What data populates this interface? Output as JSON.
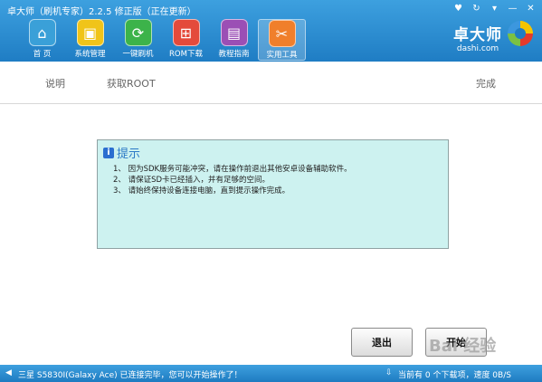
{
  "window": {
    "title": "卓大师（刷机专家）2.2.5 修正版（正在更新）",
    "controls": [
      "♥",
      "↻",
      "▾",
      "—",
      "✕"
    ]
  },
  "toolbar": {
    "items": [
      {
        "label": "首 页",
        "icon": "home-icon",
        "glyph": "⌂",
        "color": "#3aa0d8"
      },
      {
        "label": "系统管理",
        "icon": "box-icon",
        "glyph": "▣",
        "color": "#f0c419"
      },
      {
        "label": "一键刷机",
        "icon": "refresh-icon",
        "glyph": "⟳",
        "color": "#3cb34a"
      },
      {
        "label": "ROM下载",
        "icon": "cart-icon",
        "glyph": "⊞",
        "color": "#e44a3b"
      },
      {
        "label": "教程指南",
        "icon": "book-icon",
        "glyph": "▤",
        "color": "#9b4fb5"
      },
      {
        "label": "实用工具",
        "icon": "tools-icon",
        "glyph": "✂",
        "color": "#f07f2b",
        "active": true
      }
    ]
  },
  "brand": {
    "name": "卓大师",
    "domain": "dashi.com"
  },
  "steps": {
    "s1": "说明",
    "s2": "获取ROOT",
    "s3": "完成"
  },
  "tip": {
    "title": "提示",
    "icon_glyph": "i",
    "lines": [
      "1、 因为SDK服务可能冲突，请在操作前退出其他安卓设备辅助软件。",
      "2、 请保证SD卡已经插入，并有足够的空间。",
      "3、 请始终保持设备连接电脑，直到提示操作完成。"
    ]
  },
  "buttons": {
    "exit": "退出",
    "next": "开始"
  },
  "status": {
    "device_text": "三星 S5830I(Galaxy Ace) 已连接完毕，您可以开始操作了！",
    "download_text": "当前有 0 个下载项，速度 0B/S"
  },
  "watermark": "Bai 经验"
}
